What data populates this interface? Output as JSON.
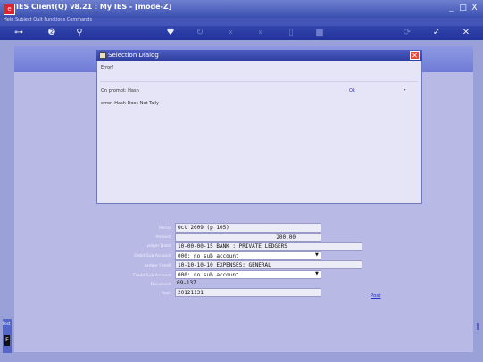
{
  "window": {
    "title": "IES Client(Q) v8.21 : My IES -     [mode-Z]",
    "menu": "Help  Subject  Quit  Functions  Commands",
    "controls": {
      "minimize": "_",
      "maximize": "□",
      "close": "X"
    }
  },
  "toolbar": {
    "icons": [
      "key-icon",
      "help-icon",
      "search-icon",
      "heart-icon",
      "refresh-icon",
      "rewind-icon",
      "fast-forward-icon",
      "delete-icon",
      "stop-icon",
      "settings-icon",
      "ok-icon",
      "close-icon"
    ],
    "glyphs": [
      "⊶",
      "❷",
      "⚲",
      "♥",
      "↻",
      "«",
      "»",
      "▯",
      "■",
      "⟳",
      "✓",
      "✕"
    ]
  },
  "dialog": {
    "title": "Selection Dialog",
    "heading": "Error!",
    "row_label": "On prompt: Hash",
    "row_option": "Ok",
    "row_arrow": "▸",
    "message": "error: Hash Does Not Tally"
  },
  "form": {
    "fields": [
      {
        "label": "Period",
        "value": "Oct 2009 (p 105)"
      },
      {
        "label": "Amount",
        "value": "200.00"
      },
      {
        "label": "Ledger Debit",
        "value": "10-00-00-15 BANK : PRIVATE LEDGERS"
      },
      {
        "label": "Debit Sub Account",
        "value": "000: no sub account"
      },
      {
        "label": "Ledger Credit",
        "value": "10-10-10-10 EXPENSES: GENERAL"
      },
      {
        "label": "Credit Sub Account",
        "value": "000: no sub account"
      },
      {
        "label": "Document",
        "value": "09-137"
      },
      {
        "label": "Hash",
        "value": "20121131"
      }
    ],
    "post_label": "Post"
  },
  "left_tab": {
    "label": "Post"
  },
  "colors": {
    "titlebar": "#3a4fb0",
    "toolbar": "#22339a",
    "content": "#b9b9e6",
    "dialog_close": "#e24a32"
  }
}
